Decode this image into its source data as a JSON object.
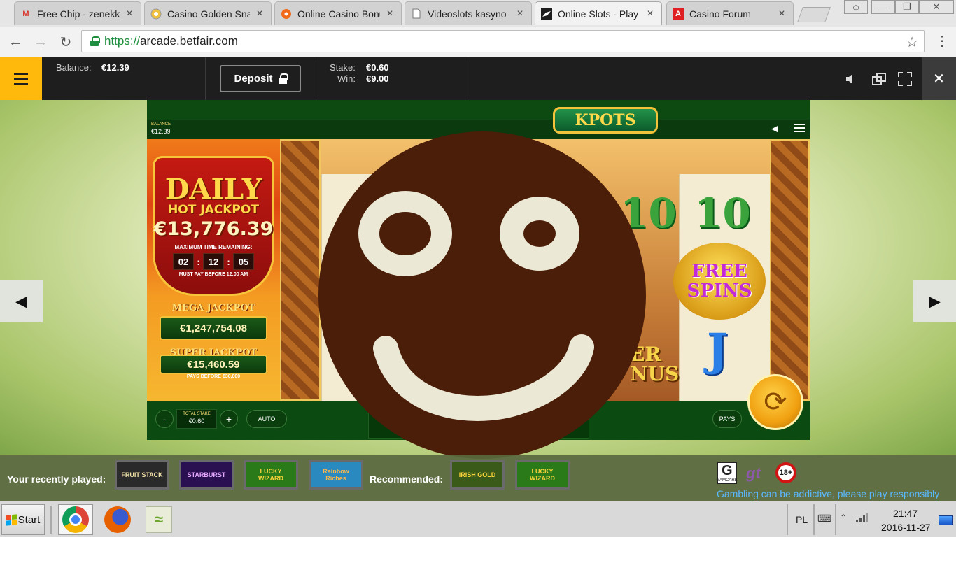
{
  "browser": {
    "tabs": [
      {
        "label": "Free Chip - zenekk",
        "icon": "gmail-icon"
      },
      {
        "label": "Casino Golden Sna",
        "icon": "casino-chip-icon"
      },
      {
        "label": "Online Casino Bonu",
        "icon": "orange-ball-icon"
      },
      {
        "label": "Videoslots kasyno",
        "icon": "page-icon"
      },
      {
        "label": "Online Slots - Play",
        "icon": "betfair-icon"
      },
      {
        "label": "Casino Forum",
        "icon": "red-a-icon"
      }
    ],
    "active_tab": 4,
    "url_scheme": "https://",
    "url_host": "arcade.betfair.com"
  },
  "site_header": {
    "balance_label": "Balance:",
    "balance_value": "€12.39",
    "deposit_label": "Deposit",
    "stake_label": "Stake:",
    "stake_value": "€0.60",
    "win_label": "Win:",
    "win_value": "€9.00"
  },
  "game": {
    "balance_label": "BALANCE",
    "balance_value": "€12.39",
    "jackpot": {
      "daily_title": "DAILY",
      "hot_title": "HOT JACKPOT",
      "daily_amount": "€13,776.39",
      "time_label": "MAXIMUM TIME REMAINING:",
      "timer": [
        "02",
        "12",
        "05"
      ],
      "must_pay": "MUST PAY BEFORE 12:00 AM",
      "mega_label": "MEGA JACKPOT",
      "mega_amount": "€1,247,754.08",
      "super_label": "SUPER JACKPOT",
      "super_amount": "€15,460.59",
      "pays_before": "PAYS BEFORE €30,000"
    },
    "logo_text": "KPOTS",
    "symbols": {
      "ten_a": "10",
      "ten_b": "10",
      "free_line1": "FREE",
      "free_line2": "SPINS",
      "j": "J",
      "bonus_line1": "ER",
      "bonus_line2": "NUS"
    },
    "bottom": {
      "minus": "-",
      "plus": "+",
      "stake_label": "TOTAL STAKE",
      "stake_value": "€0.60",
      "auto": "AUTO",
      "pays": "PAYS"
    }
  },
  "recent": {
    "recent_label": "Your recently played:",
    "recommended_label": "Recommended:",
    "recent_games": [
      {
        "name": "FRUIT STACK",
        "color": "#f2e2a8"
      },
      {
        "name": "STARBURST",
        "color": "#e5a8ff"
      },
      {
        "name": "LUCKY WIZARD",
        "color": "#f7d23a"
      },
      {
        "name": "Rainbow Riches",
        "color": "#ffb64a"
      }
    ],
    "recommended_games": [
      {
        "name": "IRISH GOLD",
        "color": "#f7d23a"
      },
      {
        "name": "LUCKY WIZARD",
        "color": "#f7d23a"
      }
    ],
    "gamcare_label": "GAMCARE",
    "gt_label": "gt",
    "age_label": "18+",
    "responsible": "Gambling can be addictive, please play responsibly"
  },
  "taskbar": {
    "start_label": "Start",
    "lang": "PL",
    "time": "21:47",
    "date": "2016-11-27"
  }
}
